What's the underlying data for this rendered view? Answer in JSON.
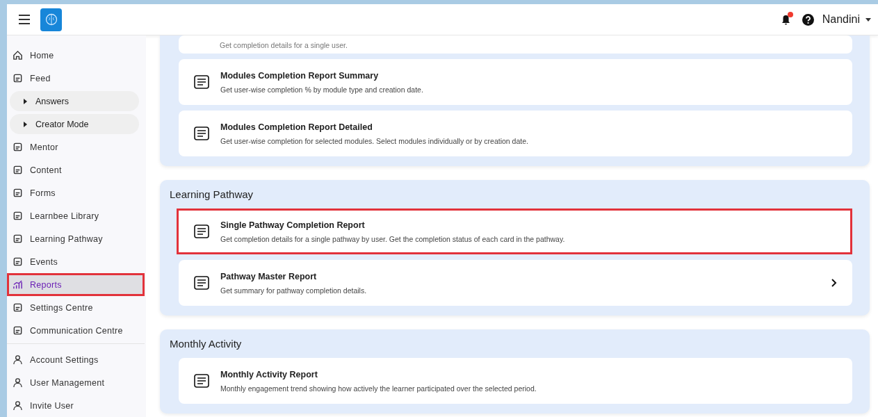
{
  "topbar": {
    "user_name": "Nandini",
    "notification_dot": true
  },
  "sidebar": {
    "items": [
      {
        "label": "Home",
        "kind": "item",
        "selected": false
      },
      {
        "label": "Feed",
        "kind": "item",
        "selected": false
      },
      {
        "label": "Answers",
        "kind": "sub",
        "selected": false
      },
      {
        "label": "Creator Mode",
        "kind": "sub",
        "selected": false
      },
      {
        "label": "Mentor",
        "kind": "item",
        "selected": false
      },
      {
        "label": "Content",
        "kind": "item",
        "selected": false
      },
      {
        "label": "Forms",
        "kind": "item",
        "selected": false
      },
      {
        "label": "Learnbee Library",
        "kind": "item",
        "selected": false
      },
      {
        "label": "Learning Pathway",
        "kind": "item",
        "selected": false
      },
      {
        "label": "Events",
        "kind": "item",
        "selected": false
      },
      {
        "label": "Reports",
        "kind": "item",
        "selected": true
      },
      {
        "label": "Settings Centre",
        "kind": "item",
        "selected": false
      },
      {
        "label": "Communication Centre",
        "kind": "item",
        "selected": false
      }
    ],
    "account_items": [
      {
        "label": "Account Settings",
        "selected": false
      },
      {
        "label": "User Management",
        "selected": false
      },
      {
        "label": "Invite User",
        "selected": false
      }
    ]
  },
  "sections": [
    {
      "cards": [
        {
          "description": "Get completion details for a single user.",
          "highlighted": false,
          "chevron": false
        },
        {
          "title": "Modules Completion Report Summary",
          "description": "Get user-wise completion % by module type and creation date.",
          "highlighted": false,
          "chevron": false
        },
        {
          "title": "Modules Completion Report Detailed",
          "description": "Get user-wise completion for selected modules. Select modules individually or by creation date.",
          "highlighted": false,
          "chevron": false
        }
      ]
    },
    {
      "title": "Learning Pathway",
      "cards": [
        {
          "title": "Single Pathway Completion Report",
          "description": "Get completion details for a single pathway by user. Get the completion status of each card in the pathway.",
          "highlighted": true,
          "chevron": false
        },
        {
          "title": "Pathway Master Report",
          "description": "Get summary for pathway completion details.",
          "highlighted": false,
          "chevron": true
        }
      ]
    },
    {
      "title": "Monthly Activity",
      "cards": [
        {
          "title": "Monthly Activity Report",
          "description": "Monthly engagement trend showing how actively the learner participated over the selected period.",
          "highlighted": false,
          "chevron": false
        }
      ]
    }
  ]
}
